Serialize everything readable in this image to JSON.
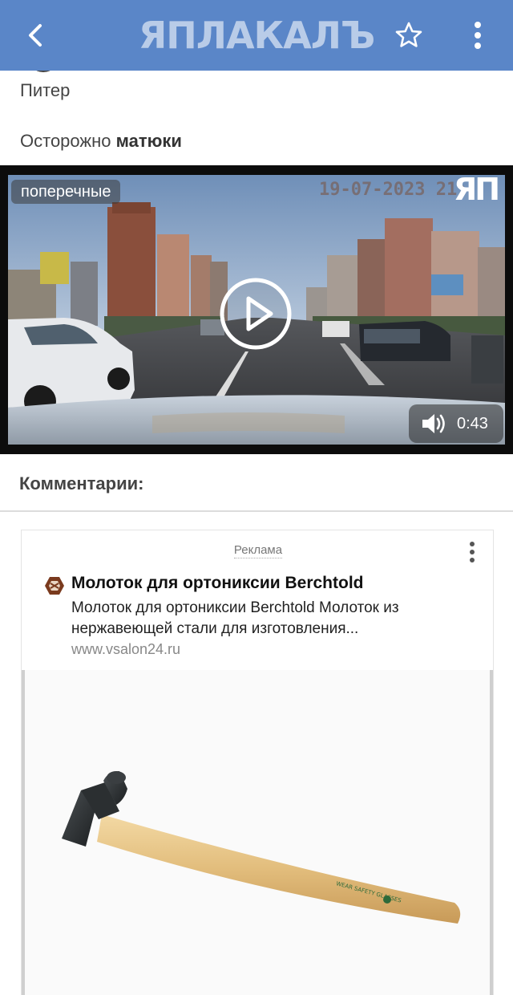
{
  "header": {
    "logo_text": "ЯПЛАКАЛЪ",
    "back_icon": "chevron-left-icon",
    "favorite_icon": "star-outline-icon",
    "menu_icon": "kebab-menu-icon",
    "bar_color": "#5a86c8"
  },
  "post": {
    "city": "Питер",
    "text_prefix": "Осторожно ",
    "text_bold": "матюки"
  },
  "video": {
    "tag": "поперечные",
    "timestamp": "19-07-2023 21:",
    "watermark": "ЯП",
    "duration": "0:43",
    "play_icon": "play-icon",
    "volume_icon": "volume-icon"
  },
  "comments": {
    "title": "Комментарии:"
  },
  "ad": {
    "label": "Реклама",
    "title": "Молоток для ортониксии Berchtold",
    "description": "Молоток для ортониксии Berchtold Молоток из нержавеющей стали для изготовления...",
    "url": "www.vsalon24.ru",
    "handle_print": "WEAR SAFETY GLASSES"
  }
}
